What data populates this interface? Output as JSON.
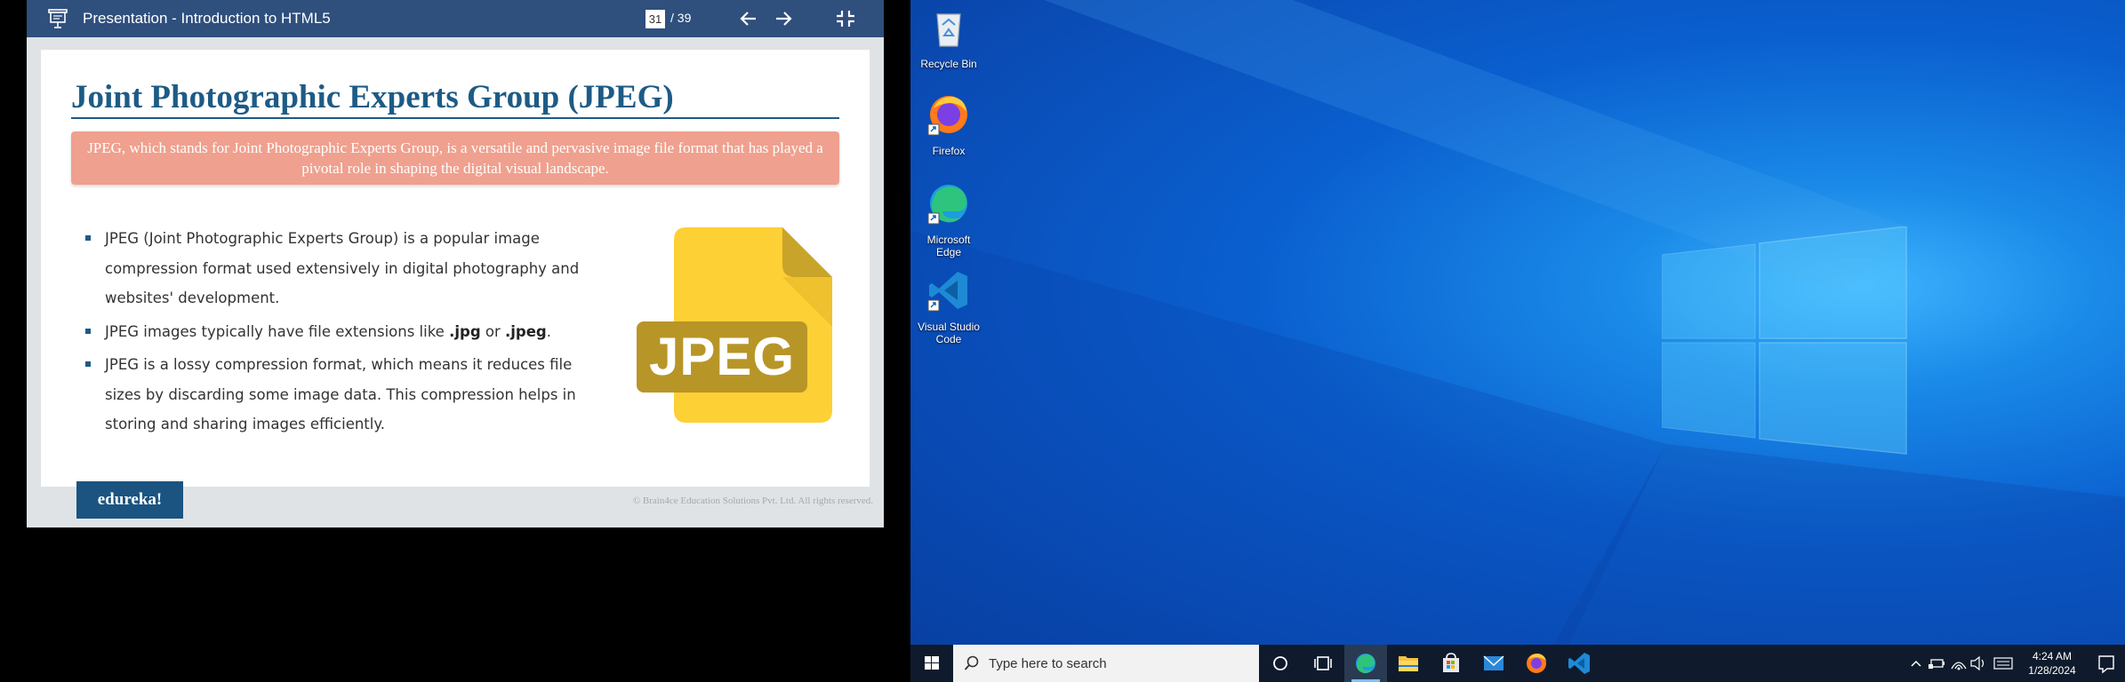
{
  "viewer": {
    "title": "Presentation - Introduction to HTML5",
    "page_current": "31",
    "page_total": "/ 39",
    "icons": {
      "presentation": "presentation-icon",
      "prev": "arrow-left-icon",
      "next": "arrow-right-icon",
      "collapse": "collapse-icon"
    }
  },
  "slide": {
    "title": "Joint Photographic Experts Group (JPEG)",
    "callout": "JPEG, which stands for Joint Photographic Experts Group, is a versatile and pervasive image file format that has played a pivotal role in shaping the digital visual landscape.",
    "bullets": [
      {
        "text": "JPEG (Joint Photographic Experts Group) is a popular image compression format used extensively in digital photography and websites' development."
      },
      {
        "pre": "JPEG images typically have file extensions like ",
        "b1": ".jpg",
        "mid": " or ",
        "b2": ".jpeg",
        "post": "."
      },
      {
        "text": "JPEG is a lossy compression format, which means it reduces file sizes by discarding some image data. This compression helps in storing and sharing images efficiently."
      }
    ],
    "graphic_label": "JPEG",
    "brand": "edureka!",
    "copyright": "© Brain4ce Education Solutions Pvt. Ltd. All rights reserved.",
    "colors": {
      "title": "#1d5b86",
      "callout": "#f0a08e",
      "doc_yellow": "#fdd035",
      "band": "#b89527",
      "brand_bg": "#1b5480"
    }
  },
  "desktop": {
    "icons": [
      {
        "label": "Recycle Bin",
        "icon": "recycle-bin-icon"
      },
      {
        "label": "Firefox",
        "icon": "firefox-icon"
      },
      {
        "label": "Microsoft Edge",
        "icon": "edge-icon"
      },
      {
        "label": "Visual Studio Code",
        "icon": "vscode-icon"
      }
    ]
  },
  "taskbar": {
    "search_placeholder": "Type here to search",
    "apps": [
      "cortana-icon",
      "task-view-icon",
      "edge-icon",
      "file-explorer-icon",
      "store-icon",
      "mail-icon",
      "firefox-icon",
      "vscode-icon"
    ],
    "time": "4:24 AM",
    "date": "1/28/2024",
    "tray": [
      "chevron-up-icon",
      "battery-icon",
      "network-icon",
      "volume-icon",
      "keyboard-icon"
    ]
  }
}
